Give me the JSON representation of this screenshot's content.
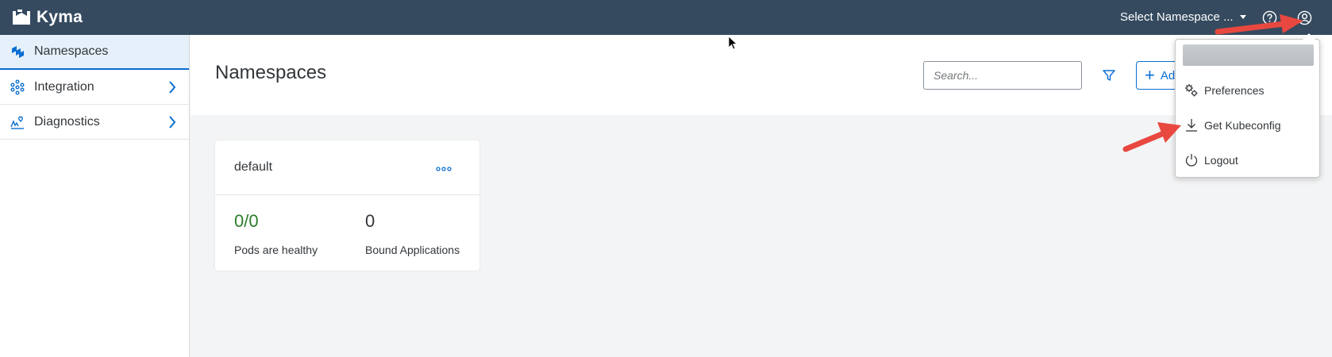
{
  "app": {
    "title": "Kyma"
  },
  "topbar": {
    "namespace_select": "Select Namespace ...",
    "help_icon": "question-circle-icon",
    "user_icon": "user-circle-icon"
  },
  "sidebar": {
    "items": [
      {
        "label": "Namespaces",
        "icon": "namespaces-icon",
        "active": true
      },
      {
        "label": "Integration",
        "icon": "integration-icon",
        "has_children": true
      },
      {
        "label": "Diagnostics",
        "icon": "diagnostics-icon",
        "has_children": true
      }
    ]
  },
  "header": {
    "title": "Namespaces",
    "search_placeholder": "Search...",
    "add_label": "Ad"
  },
  "cards": [
    {
      "name": "default",
      "pods_value": "0/0",
      "pods_label": "Pods are healthy",
      "bound_value": "0",
      "bound_label": "Bound Applications"
    }
  ],
  "user_menu": {
    "items": [
      {
        "label": "Preferences",
        "icon": "gears-icon"
      },
      {
        "label": "Get Kubeconfig",
        "icon": "download-icon"
      },
      {
        "label": "Logout",
        "icon": "power-icon"
      }
    ]
  },
  "colors": {
    "topbar": "#354a5f",
    "accent": "#0a6ed1",
    "healthy": "#2b7d2b",
    "annotation_arrow": "#e8483f"
  }
}
